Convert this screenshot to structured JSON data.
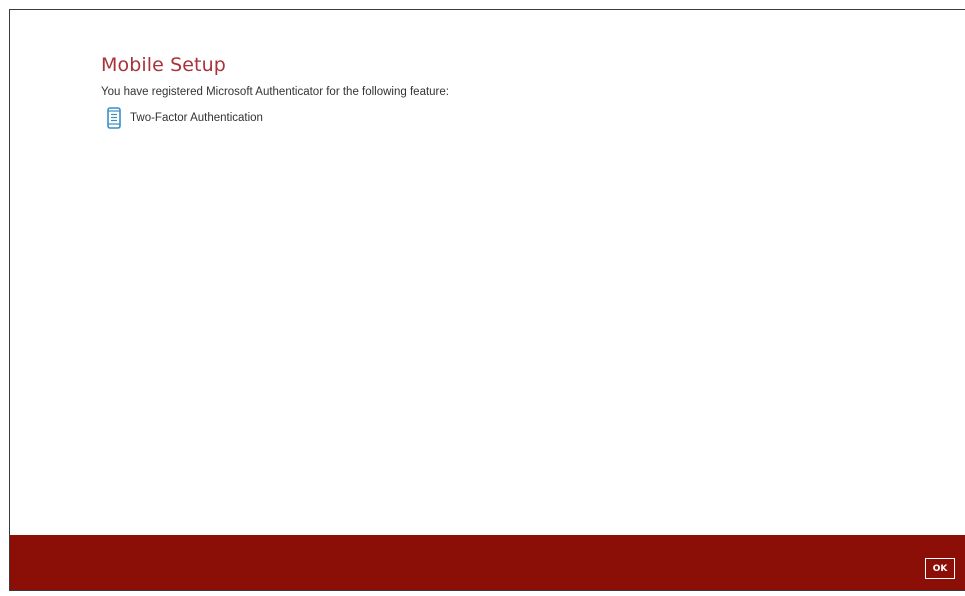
{
  "dialog": {
    "title": "Mobile Setup",
    "description": "You have registered Microsoft Authenticator for the following feature:",
    "features": [
      {
        "label": "Two-Factor Authentication",
        "icon": "mobile-phone-icon"
      }
    ]
  },
  "footer": {
    "ok_label": "OK"
  },
  "colors": {
    "title": "#a7333b",
    "footer_bg": "#8c0f07",
    "icon": "#3a8fc4"
  }
}
